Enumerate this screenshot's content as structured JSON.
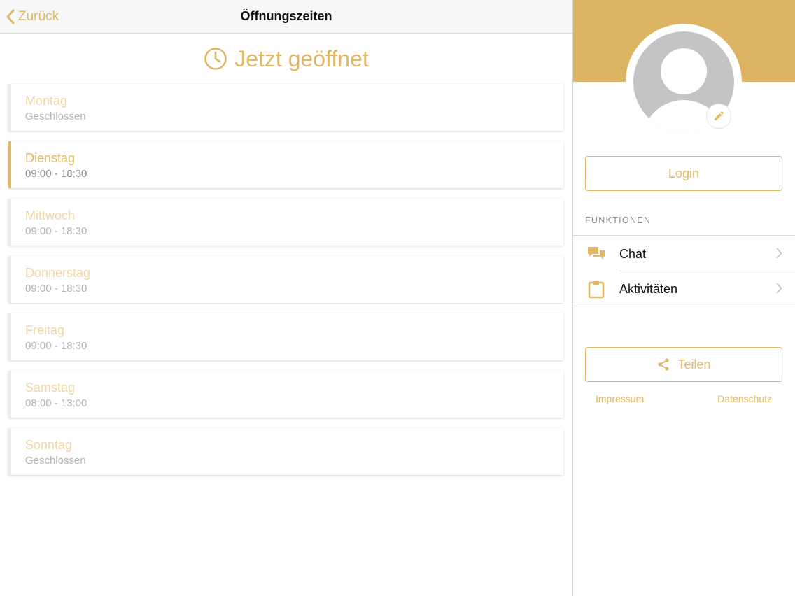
{
  "colors": {
    "accent": "#e1b866",
    "banner": "#ddb462",
    "avatar": "#c4c4c6"
  },
  "navbar": {
    "back_label": "Zurück",
    "title": "Öffnungszeiten"
  },
  "status": {
    "icon": "clock-icon",
    "text": "Jetzt geöffnet"
  },
  "days": [
    {
      "name": "Montag",
      "hours": "Geschlossen",
      "active": false
    },
    {
      "name": "Dienstag",
      "hours": "09:00 - 18:30",
      "active": true
    },
    {
      "name": "Mittwoch",
      "hours": "09:00 - 18:30",
      "active": false
    },
    {
      "name": "Donnerstag",
      "hours": "09:00 - 18:30",
      "active": false
    },
    {
      "name": "Freitag",
      "hours": "09:00 - 18:30",
      "active": false
    },
    {
      "name": "Samstag",
      "hours": "08:00 - 13:00",
      "active": false
    },
    {
      "name": "Sonntag",
      "hours": "Geschlossen",
      "active": false
    }
  ],
  "sidebar": {
    "login_label": "Login",
    "section_label": "FUNKTIONEN",
    "menu": [
      {
        "label": "Chat",
        "icon": "chat-icon"
      },
      {
        "label": "Aktivitäten",
        "icon": "clipboard-icon"
      }
    ],
    "share_label": "Teilen",
    "links": {
      "impressum": "Impressum",
      "datenschutz": "Datenschutz"
    }
  }
}
